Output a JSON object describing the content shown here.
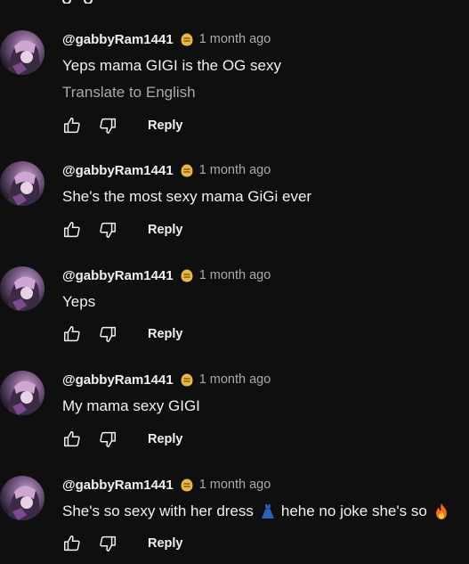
{
  "comments": [
    {
      "author": "@gabbyRam1441",
      "time": "1 month ago",
      "text": "Yeps mama GIGI is the OG sexy",
      "translate": "Translate to English",
      "reply_label": "Reply"
    },
    {
      "author": "@gabbyRam1441",
      "time": "1 month ago",
      "text": "She's the most sexy mama GiGi ever",
      "reply_label": "Reply"
    },
    {
      "author": "@gabbyRam1441",
      "time": "1 month ago",
      "text": "Yeps",
      "reply_label": "Reply"
    },
    {
      "author": "@gabbyRam1441",
      "time": "1 month ago",
      "text": "My mama sexy GIGI",
      "reply_label": "Reply"
    },
    {
      "author": "@gabbyRam1441",
      "time": "1 month ago",
      "text_part1": "She's so sexy with her dress",
      "emoji1": "dress-emoji",
      "text_part2": "hehe no joke she's so",
      "emoji2": "fire-emoji",
      "reply_label": "Reply"
    }
  ],
  "icons": {
    "badge": "member-badge-icon",
    "like": "thumbs-up-icon",
    "dislike": "thumbs-down-icon"
  },
  "colors": {
    "background": "#0f0f0f",
    "primary_text": "#f1f1f1",
    "secondary_text": "#aaaaaa",
    "badge": "#e8b64a"
  }
}
